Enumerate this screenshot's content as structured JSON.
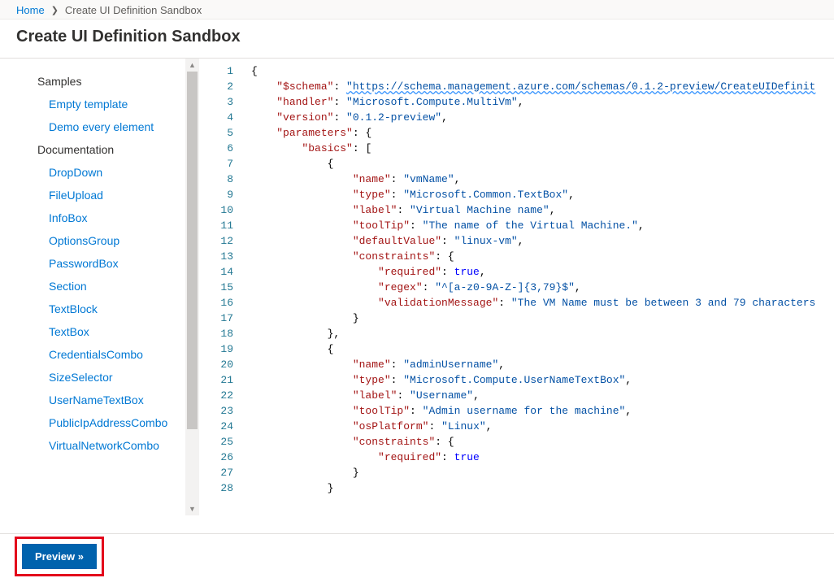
{
  "breadcrumb": {
    "home": "Home",
    "current": "Create UI Definition Sandbox"
  },
  "title": "Create UI Definition Sandbox",
  "sidebar": {
    "sections": [
      {
        "header": "Samples",
        "items": [
          "Empty template",
          "Demo every element"
        ]
      },
      {
        "header": "Documentation",
        "items": [
          "DropDown",
          "FileUpload",
          "InfoBox",
          "OptionsGroup",
          "PasswordBox",
          "Section",
          "TextBlock",
          "TextBox",
          "CredentialsCombo",
          "SizeSelector",
          "UserNameTextBox",
          "PublicIpAddressCombo",
          "VirtualNetworkCombo"
        ]
      }
    ]
  },
  "editor": {
    "lines": [
      {
        "n": 1,
        "indent": 0,
        "tokens": [
          [
            "punc",
            "{"
          ]
        ]
      },
      {
        "n": 2,
        "indent": 1,
        "tokens": [
          [
            "key",
            "\"$schema\""
          ],
          [
            "punc",
            ": "
          ],
          [
            "url",
            "\"https://schema.management.azure.com/schemas/0.1.2-preview/CreateUIDefinit"
          ]
        ]
      },
      {
        "n": 3,
        "indent": 1,
        "tokens": [
          [
            "key",
            "\"handler\""
          ],
          [
            "punc",
            ": "
          ],
          [
            "str",
            "\"Microsoft.Compute.MultiVm\""
          ],
          [
            "punc",
            ","
          ]
        ]
      },
      {
        "n": 4,
        "indent": 1,
        "tokens": [
          [
            "key",
            "\"version\""
          ],
          [
            "punc",
            ": "
          ],
          [
            "str",
            "\"0.1.2-preview\""
          ],
          [
            "punc",
            ","
          ]
        ]
      },
      {
        "n": 5,
        "indent": 1,
        "tokens": [
          [
            "key",
            "\"parameters\""
          ],
          [
            "punc",
            ": {"
          ]
        ]
      },
      {
        "n": 6,
        "indent": 2,
        "tokens": [
          [
            "key",
            "\"basics\""
          ],
          [
            "punc",
            ": ["
          ]
        ]
      },
      {
        "n": 7,
        "indent": 3,
        "tokens": [
          [
            "punc",
            "{"
          ]
        ]
      },
      {
        "n": 8,
        "indent": 4,
        "tokens": [
          [
            "key",
            "\"name\""
          ],
          [
            "punc",
            ": "
          ],
          [
            "str",
            "\"vmName\""
          ],
          [
            "punc",
            ","
          ]
        ]
      },
      {
        "n": 9,
        "indent": 4,
        "tokens": [
          [
            "key",
            "\"type\""
          ],
          [
            "punc",
            ": "
          ],
          [
            "str",
            "\"Microsoft.Common.TextBox\""
          ],
          [
            "punc",
            ","
          ]
        ]
      },
      {
        "n": 10,
        "indent": 4,
        "tokens": [
          [
            "key",
            "\"label\""
          ],
          [
            "punc",
            ": "
          ],
          [
            "str",
            "\"Virtual Machine name\""
          ],
          [
            "punc",
            ","
          ]
        ]
      },
      {
        "n": 11,
        "indent": 4,
        "tokens": [
          [
            "key",
            "\"toolTip\""
          ],
          [
            "punc",
            ": "
          ],
          [
            "str",
            "\"The name of the Virtual Machine.\""
          ],
          [
            "punc",
            ","
          ]
        ]
      },
      {
        "n": 12,
        "indent": 4,
        "tokens": [
          [
            "key",
            "\"defaultValue\""
          ],
          [
            "punc",
            ": "
          ],
          [
            "str",
            "\"linux-vm\""
          ],
          [
            "punc",
            ","
          ]
        ]
      },
      {
        "n": 13,
        "indent": 4,
        "tokens": [
          [
            "key",
            "\"constraints\""
          ],
          [
            "punc",
            ": {"
          ]
        ]
      },
      {
        "n": 14,
        "indent": 5,
        "tokens": [
          [
            "key",
            "\"required\""
          ],
          [
            "punc",
            ": "
          ],
          [
            "bool",
            "true"
          ],
          [
            "punc",
            ","
          ]
        ]
      },
      {
        "n": 15,
        "indent": 5,
        "tokens": [
          [
            "key",
            "\"regex\""
          ],
          [
            "punc",
            ": "
          ],
          [
            "str",
            "\"^[a-z0-9A-Z-]{3,79}$\""
          ],
          [
            "punc",
            ","
          ]
        ]
      },
      {
        "n": 16,
        "indent": 5,
        "tokens": [
          [
            "key",
            "\"validationMessage\""
          ],
          [
            "punc",
            ": "
          ],
          [
            "str",
            "\"The VM Name must be between 3 and 79 characters"
          ]
        ]
      },
      {
        "n": 17,
        "indent": 4,
        "tokens": [
          [
            "punc",
            "}"
          ]
        ]
      },
      {
        "n": 18,
        "indent": 3,
        "tokens": [
          [
            "punc",
            "},"
          ]
        ]
      },
      {
        "n": 19,
        "indent": 3,
        "tokens": [
          [
            "punc",
            "{"
          ]
        ]
      },
      {
        "n": 20,
        "indent": 4,
        "tokens": [
          [
            "key",
            "\"name\""
          ],
          [
            "punc",
            ": "
          ],
          [
            "str",
            "\"adminUsername\""
          ],
          [
            "punc",
            ","
          ]
        ]
      },
      {
        "n": 21,
        "indent": 4,
        "tokens": [
          [
            "key",
            "\"type\""
          ],
          [
            "punc",
            ": "
          ],
          [
            "str",
            "\"Microsoft.Compute.UserNameTextBox\""
          ],
          [
            "punc",
            ","
          ]
        ]
      },
      {
        "n": 22,
        "indent": 4,
        "tokens": [
          [
            "key",
            "\"label\""
          ],
          [
            "punc",
            ": "
          ],
          [
            "str",
            "\"Username\""
          ],
          [
            "punc",
            ","
          ]
        ]
      },
      {
        "n": 23,
        "indent": 4,
        "tokens": [
          [
            "key",
            "\"toolTip\""
          ],
          [
            "punc",
            ": "
          ],
          [
            "str",
            "\"Admin username for the machine\""
          ],
          [
            "punc",
            ","
          ]
        ]
      },
      {
        "n": 24,
        "indent": 4,
        "tokens": [
          [
            "key",
            "\"osPlatform\""
          ],
          [
            "punc",
            ": "
          ],
          [
            "str",
            "\"Linux\""
          ],
          [
            "punc",
            ","
          ]
        ]
      },
      {
        "n": 25,
        "indent": 4,
        "tokens": [
          [
            "key",
            "\"constraints\""
          ],
          [
            "punc",
            ": {"
          ]
        ]
      },
      {
        "n": 26,
        "indent": 5,
        "tokens": [
          [
            "key",
            "\"required\""
          ],
          [
            "punc",
            ": "
          ],
          [
            "bool",
            "true"
          ]
        ]
      },
      {
        "n": 27,
        "indent": 4,
        "tokens": [
          [
            "punc",
            "}"
          ]
        ]
      },
      {
        "n": 28,
        "indent": 3,
        "tokens": [
          [
            "punc",
            "}"
          ]
        ]
      }
    ]
  },
  "footer": {
    "previewLabel": "Preview »"
  }
}
